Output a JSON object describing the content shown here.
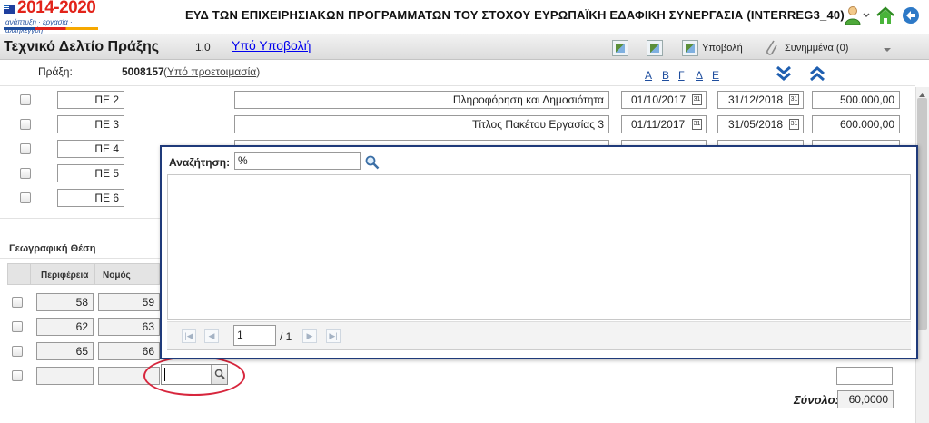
{
  "header": {
    "logo": {
      "year": "2014-2020",
      "slogan": "ανάπτυξη · εργασία · αλληλεγγύη"
    },
    "title": "ΕΥΔ ΤΩΝ ΕΠΙΧΕΙΡΗΣΙΑΚΩΝ ΠΡΟΓΡΑΜΜΑΤΩΝ ΤΟΥ ΣΤΟΧΟΥ ΕΥΡΩΠΑΪΚΗ ΕΔΑΦΙΚΗ ΣΥΝΕΡΓΑΣΙΑ (INTERREG3_40)",
    "icons": [
      "user-icon",
      "home-icon",
      "back-icon"
    ]
  },
  "titlebar": {
    "title": "Τεχνικό Δελτίο Πράξης",
    "version": "1.0",
    "status_link": "Υπό Υποβολή",
    "submit_label": "Υποβολή",
    "attachments_label": "Συνημμένα (0)"
  },
  "info": {
    "praxi_label": "Πράξη:",
    "praxi_number": "5008157",
    "praxi_status": "Υπό προετοιμασία",
    "letters": [
      "Α",
      "Β",
      "Γ",
      "Δ",
      "Ε"
    ]
  },
  "work_packages": [
    {
      "code": "ΠΕ 2",
      "title": "Πληροφόρηση και Δημοσιότητα",
      "start": "01/10/2017",
      "end": "31/12/2018",
      "amount": "500.000,00"
    },
    {
      "code": "ΠΕ 3",
      "title": "Τίτλος Πακέτου Εργασίας 3",
      "start": "01/11/2017",
      "end": "31/05/2018",
      "amount": "600.000,00"
    },
    {
      "code": "ΠΕ 4",
      "title": "",
      "start": "",
      "end": "",
      "amount": ""
    },
    {
      "code": "ΠΕ 5",
      "title": "",
      "start": "",
      "end": "",
      "amount": ""
    },
    {
      "code": "ΠΕ 6",
      "title": "",
      "start": "",
      "end": "",
      "amount": ""
    }
  ],
  "geo": {
    "title": "Γεωγραφική Θέση",
    "columns": [
      "Περιφέρεια",
      "Νομός"
    ],
    "rows": [
      {
        "periferia": "58",
        "nomos": "59"
      },
      {
        "periferia": "62",
        "nomos": "63"
      },
      {
        "periferia": "65",
        "nomos": "66"
      }
    ]
  },
  "popup": {
    "search_label": "Αναζήτηση:",
    "search_value": "%",
    "page_value": "1",
    "page_total": "/ 1"
  },
  "summary": {
    "label": "Σύνολο:",
    "value": "60,0000"
  }
}
